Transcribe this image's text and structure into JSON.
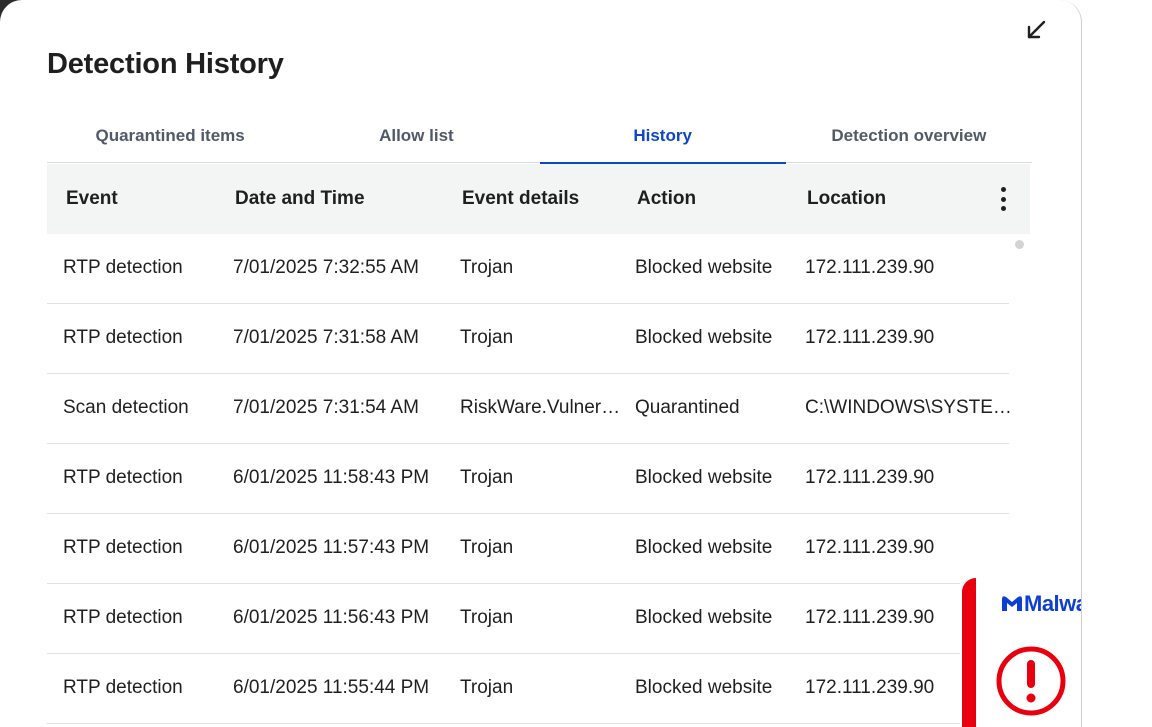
{
  "page": {
    "title": "Detection History",
    "collapse_icon": "arrow-down-left-icon"
  },
  "tabs": [
    {
      "label": "Quarantined items",
      "active": false
    },
    {
      "label": "Allow list",
      "active": false
    },
    {
      "label": "History",
      "active": true
    },
    {
      "label": "Detection overview",
      "active": false
    }
  ],
  "table": {
    "columns": [
      "Event",
      "Date and Time",
      "Event details",
      "Action",
      "Location"
    ],
    "menu_icon": "more-vertical-icon",
    "rows": [
      {
        "event": "RTP detection",
        "datetime": "7/01/2025 7:32:55 AM",
        "details": "Trojan",
        "action": "Blocked website",
        "location": "172.111.239.90"
      },
      {
        "event": "RTP detection",
        "datetime": "7/01/2025 7:31:58 AM",
        "details": "Trojan",
        "action": "Blocked website",
        "location": "172.111.239.90"
      },
      {
        "event": "Scan detection",
        "datetime": "7/01/2025 7:31:54 AM",
        "details": "RiskWare.Vulner…",
        "action": "Quarantined",
        "location": "C:\\WINDOWS\\SYSTE…"
      },
      {
        "event": "RTP detection",
        "datetime": "6/01/2025 11:58:43 PM",
        "details": "Trojan",
        "action": "Blocked website",
        "location": "172.111.239.90"
      },
      {
        "event": "RTP detection",
        "datetime": "6/01/2025 11:57:43 PM",
        "details": "Trojan",
        "action": "Blocked website",
        "location": "172.111.239.90"
      },
      {
        "event": "RTP detection",
        "datetime": "6/01/2025 11:56:43 PM",
        "details": "Trojan",
        "action": "Blocked website",
        "location": "172.111.239.90"
      },
      {
        "event": "RTP detection",
        "datetime": "6/01/2025 11:55:44 PM",
        "details": "Trojan",
        "action": "Blocked website",
        "location": "172.111.239.90"
      }
    ]
  },
  "toast": {
    "logo_text": "Malwa",
    "alert_icon": "exclamation-circle-icon",
    "accent_color": "#e8000e",
    "brand_color": "#0d3fd4"
  },
  "colors": {
    "active_tab": "#0d47c4",
    "header_bg": "#f3f4f4"
  }
}
